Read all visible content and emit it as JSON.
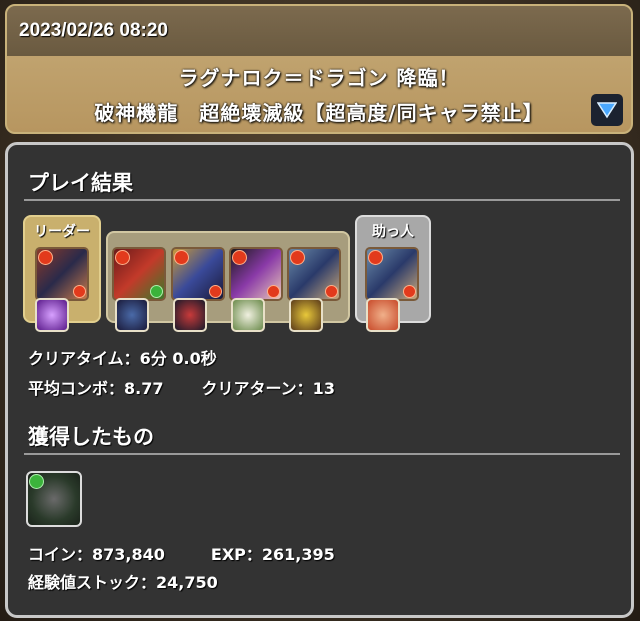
{
  "header": {
    "datetime": "2023/02/26 08:20",
    "quest_line1": "ラグナロク＝ドラゴン 降臨！",
    "quest_line2": "破神機龍　超絶壊滅級【超高度/同キャラ禁止】",
    "dropdown_icon": "triangle-down-icon"
  },
  "result": {
    "title": "プレイ結果",
    "leader_label": "リーダー",
    "helper_label": "助っ人",
    "clear_time": "クリアタイム：6分 0.0秒",
    "avg_combo": "平均コンボ：8.77",
    "clear_turns": "クリアターン：13"
  },
  "rewards": {
    "title": "獲得したもの",
    "coins": "コイン：873,840",
    "exp": "EXP：261,395",
    "exp_stock": "経験値ストック：24,750"
  },
  "colors": {
    "fire_attr": "#e23a1c",
    "wood_attr": "#3bb33b",
    "leader_frame": "#c9b06d",
    "helper_frame": "#a8a8a8"
  }
}
